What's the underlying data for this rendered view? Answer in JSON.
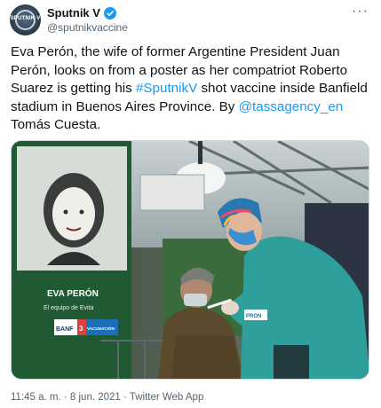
{
  "tweet": {
    "author": {
      "display_name": "Sputnik V",
      "handle": "@sputnikvaccine",
      "avatar_text": "SPUTNIK V",
      "verified_icon": "verified-badge-icon"
    },
    "more_icon": "more-options-icon",
    "text_parts": {
      "p1": "Eva Perón, the wife of former Argentine President Juan Perón, looks on from a poster as her compatriot Roberto Suarez is getting his ",
      "hashtag": "#SputnikV",
      "p2": " shot vaccine inside Banfield stadium in Buenos Aires Province. By ",
      "mention": "@tassagency_en",
      "p3": " Tomás Cuesta."
    },
    "photo": {
      "poster_name": "EVA PERÓN",
      "poster_subtitle": "El equipo de Evita",
      "sign_left": "BANF",
      "sign_number": "3",
      "sign_right": "VACUNACIÓN",
      "small_sign": "PRON"
    },
    "timestamp": "11:45 a. m. · 8 jun. 2021 · Twitter Web App"
  },
  "colors": {
    "link": "#1d9bf0",
    "secondary_text": "#536471",
    "primary_text": "#0f1419",
    "poster_green": "#2d7a3e"
  }
}
